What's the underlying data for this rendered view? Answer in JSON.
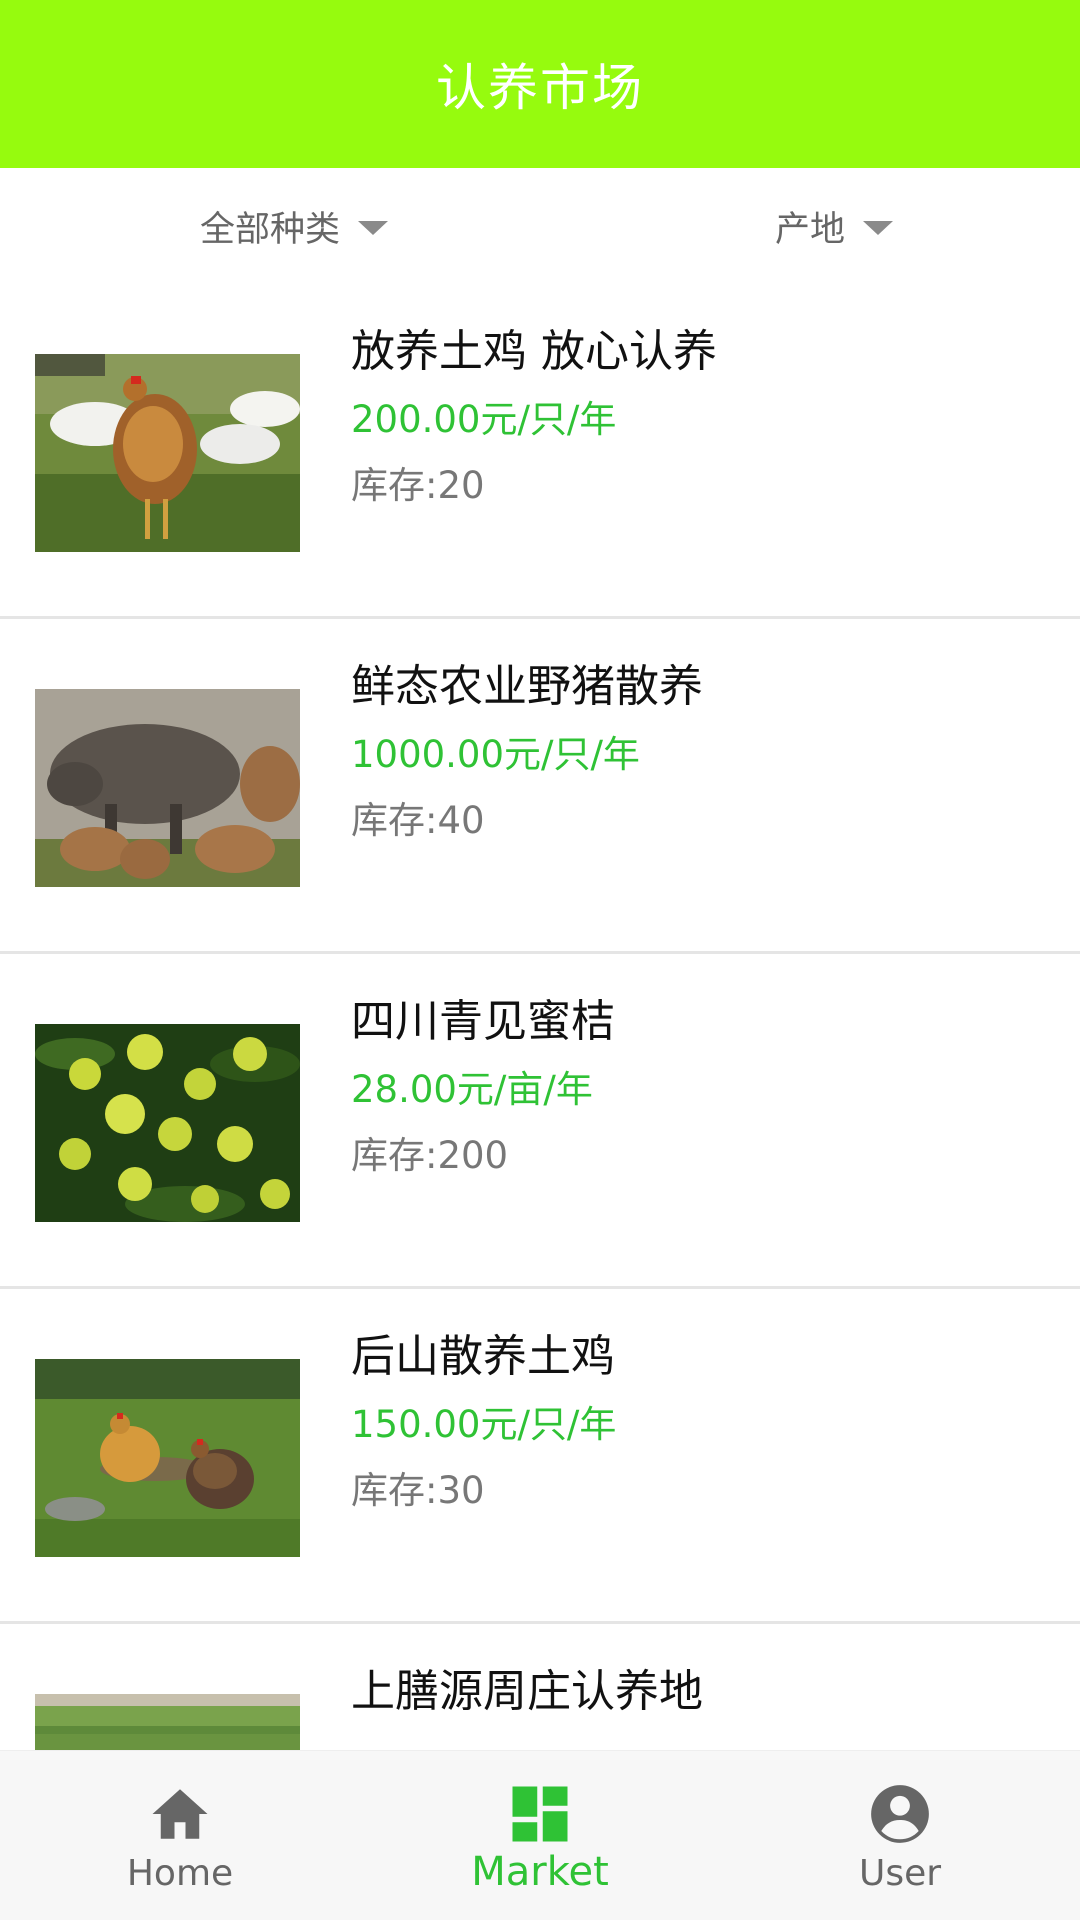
{
  "header": {
    "title": "认养市场"
  },
  "filters": {
    "category": {
      "label": "全部种类",
      "icon": "caret-down-icon"
    },
    "origin": {
      "label": "产地",
      "icon": "caret-down-icon"
    }
  },
  "items": [
    {
      "title": "放养土鸡 放心认养",
      "price": "200.00元/只/年",
      "stock": "库存:20",
      "image": "free-range-chicken-photo"
    },
    {
      "title": "鲜态农业野猪散养",
      "price": "1000.00元/只/年",
      "stock": "库存:40",
      "image": "wild-boar-photo"
    },
    {
      "title": "四川青见蜜桔",
      "price": "28.00元/亩/年",
      "stock": "库存:200",
      "image": "green-citrus-photo"
    },
    {
      "title": "后山散养土鸡",
      "price": "150.00元/只/年",
      "stock": "库存:30",
      "image": "hillside-chickens-photo"
    },
    {
      "title": "上膳源周庄认养地",
      "price": "",
      "stock": "",
      "image": "farmland-photo"
    }
  ],
  "tabbar": {
    "active": "market",
    "colors": {
      "active": "#2fc235",
      "inactive": "#666666"
    },
    "tabs": [
      {
        "label": "Home",
        "icon": "home-icon"
      },
      {
        "label": "Market",
        "icon": "dashboard-grid-icon"
      },
      {
        "label": "User",
        "icon": "account-circle-icon"
      }
    ]
  },
  "colors": {
    "header_bg": "#96fb0e",
    "price": "#2fc235",
    "stock": "#777777",
    "divider": "#e5e5e5"
  }
}
